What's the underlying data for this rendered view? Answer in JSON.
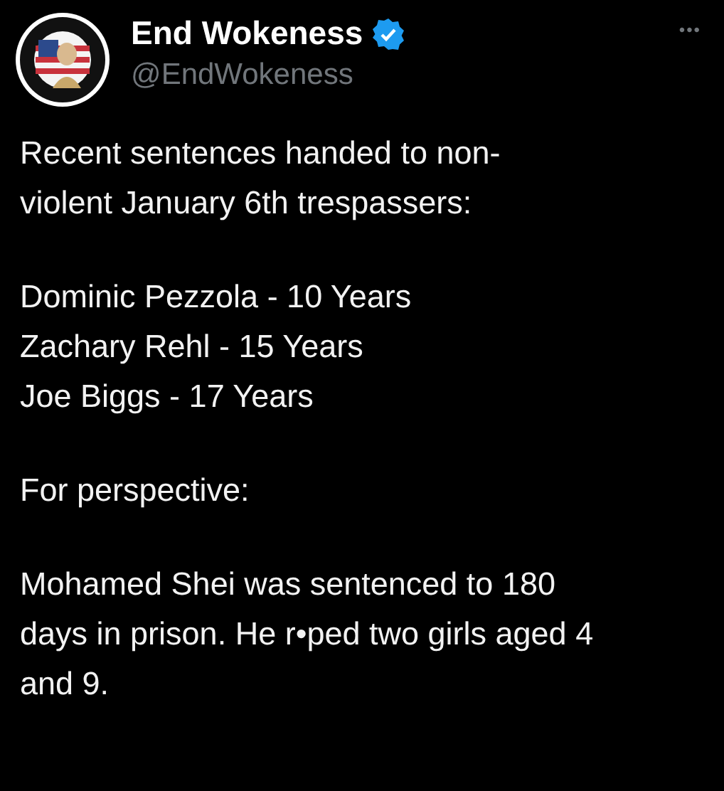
{
  "author": {
    "name": "End Wokeness",
    "verified": true,
    "handle": "@EndWokeness"
  },
  "menu": "•••",
  "paragraphs": [
    [
      "Recent sentences handed to non-",
      "violent January 6th trespassers:"
    ],
    [
      "Dominic Pezzola - 10 Years",
      "Zachary Rehl - 15 Years",
      "Joe Biggs - 17 Years"
    ],
    [
      "For perspective:"
    ],
    [
      "Mohamed Shei was sentenced to 180",
      "days in prison. He r•ped two girls aged 4",
      "and 9."
    ]
  ]
}
